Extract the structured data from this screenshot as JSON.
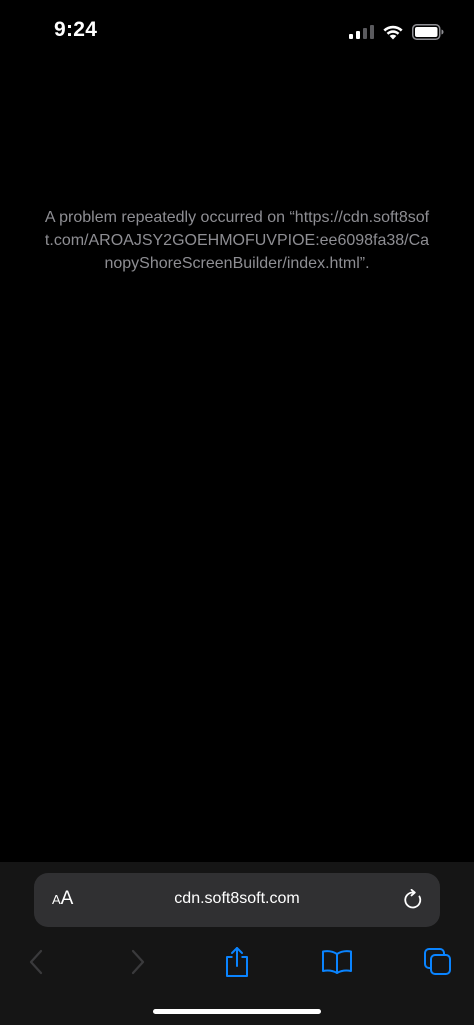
{
  "status_bar": {
    "time": "9:24",
    "signal_icon": "signal-bars-icon",
    "wifi_icon": "wifi-icon",
    "battery_icon": "battery-icon"
  },
  "error": {
    "message": "A problem repeatedly occurred on “https://cdn.soft8soft.com/AROAJSY2GOEHMOFUVPIOE:ee6098fa38/CanopyShoreScreenBuilder/index.html”."
  },
  "address_bar": {
    "reader_small": "A",
    "reader_large": "A",
    "url": "cdn.soft8soft.com",
    "reload_icon": "reload-icon"
  },
  "toolbar": {
    "back_icon": "chevron-left-icon",
    "forward_icon": "chevron-right-icon",
    "share_icon": "share-icon",
    "bookmarks_icon": "book-icon",
    "tabs_icon": "tabs-icon"
  },
  "colors": {
    "background": "#000000",
    "message_text": "#8e8e93",
    "toolbar_bg": "#151515",
    "address_bar_bg": "#303032",
    "accent": "#0a84ff",
    "disabled": "#3a3a3c"
  }
}
